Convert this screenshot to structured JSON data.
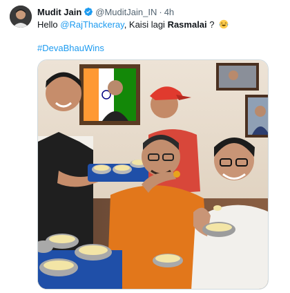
{
  "post": {
    "author_name": "Mudit Jain",
    "author_handle": "@MuditJain_IN",
    "separator": "·",
    "time": "4h",
    "text": {
      "greeting": "Hello",
      "mention": "@RajThackeray",
      "middle": ", Kaisi lagi",
      "bold_word": "Rasmalai",
      "ending": "?",
      "emoji_name": "laughing-tears-emoji",
      "hashtag": "#DevaBhauWins"
    },
    "media_description_icon": "photo",
    "colors": {
      "link": "#1d9bf0",
      "verified": "#1d9bf0",
      "secondary_text": "#536471"
    }
  }
}
